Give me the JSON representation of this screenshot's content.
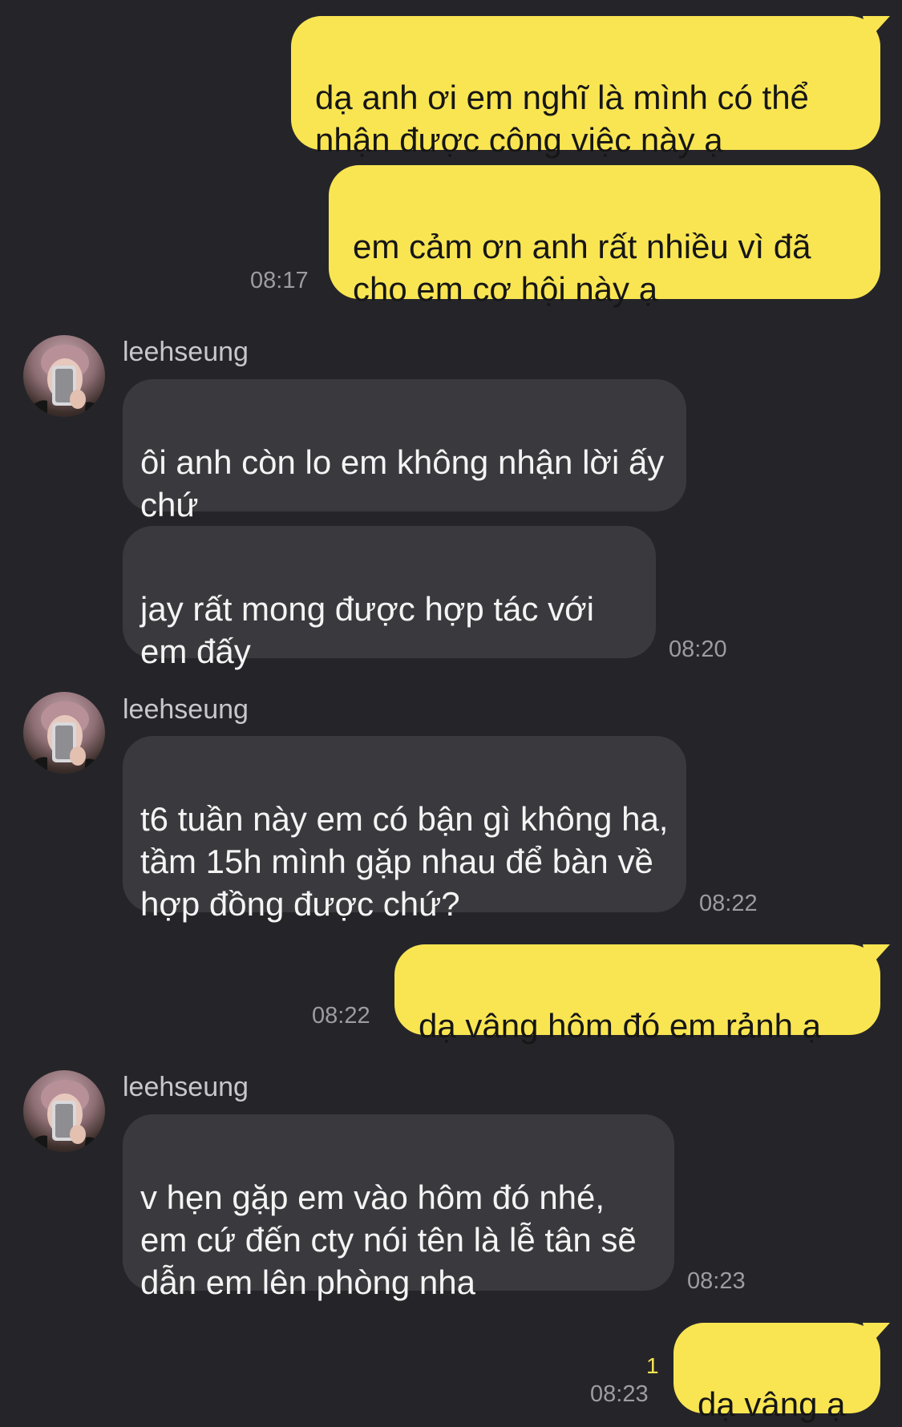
{
  "colors": {
    "background": "#252529",
    "outgoing_bubble": "#f9e552",
    "incoming_bubble": "#3a3a3e",
    "timestamp": "#9c9ca1",
    "unread": "#f9e552"
  },
  "messages": [
    {
      "direction": "out",
      "text": "dạ anh ơi em nghĩ là mình có thể nhận được công việc này ạ"
    },
    {
      "direction": "out",
      "text": "em cảm ơn anh rất nhiều vì đã cho em cơ hội này ạ",
      "time": "08:17"
    },
    {
      "direction": "in",
      "sender": "leehseung",
      "text": "ôi anh còn lo em không nhận lời ấy chứ"
    },
    {
      "direction": "in",
      "text": "jay rất mong được hợp tác với em đấy",
      "time": "08:20"
    },
    {
      "direction": "in",
      "sender": "leehseung",
      "text": "t6 tuần này em có bận gì không ha, tầm 15h mình gặp nhau để bàn về hợp đồng được chứ?",
      "time": "08:22"
    },
    {
      "direction": "out",
      "text": "dạ vâng hôm đó em rảnh ạ",
      "time": "08:22"
    },
    {
      "direction": "in",
      "sender": "leehseung",
      "text": "v hẹn gặp em vào hôm đó nhé, em cứ đến cty nói tên là lễ tân sẽ dẫn em lên phòng nha",
      "time": "08:23"
    },
    {
      "direction": "out",
      "text": "dạ vâng ạ",
      "time": "08:23",
      "unread_count": "1"
    }
  ],
  "icons": {
    "avatar": "user-avatar-photo"
  }
}
